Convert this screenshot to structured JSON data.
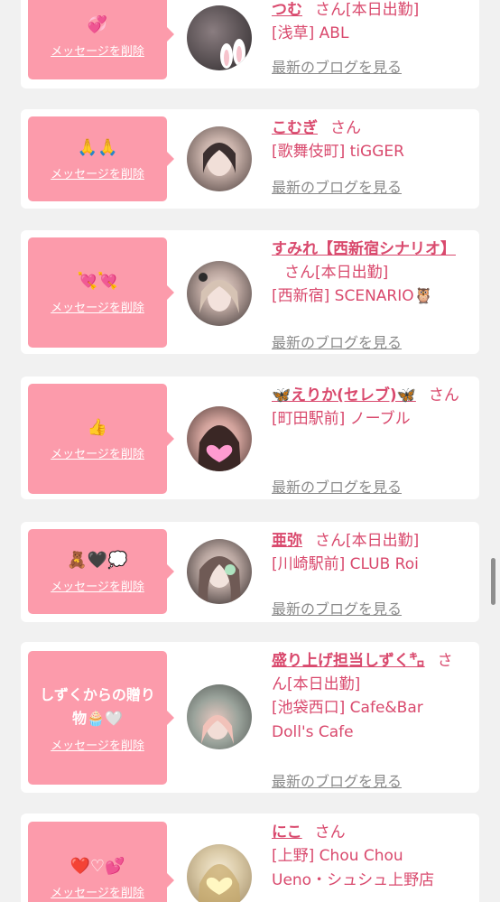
{
  "labels": {
    "delete": "メッセージを削除",
    "blog": "最新のブログを見る",
    "san": "さん"
  },
  "cards": [
    {
      "message": "💞",
      "name": "つむ",
      "status": "[本日出勤]",
      "area_line1": "[浅草] ABL",
      "area_line2": ""
    },
    {
      "message": "🙏🙏",
      "name": "こむぎ",
      "status": "",
      "area_line1": "[歌舞伎町] tiGGER",
      "area_line2": ""
    },
    {
      "message": "💘💘",
      "name": "すみれ【西新宿シナリオ】",
      "status": "[本日出勤]",
      "area_line1": "[西新宿] SCENARIO🦉",
      "area_line2": ""
    },
    {
      "message": "👍",
      "name": "🦋えりか(セレブ)🦋",
      "status": "",
      "area_line1": "[町田駅前] ノーブル",
      "area_line2": ""
    },
    {
      "message": "🧸🖤💭",
      "name": "亜弥",
      "status": "[本日出勤]",
      "area_line1": "[川崎駅前] CLUB Roi",
      "area_line2": ""
    },
    {
      "message": "しずくからの贈り物🧁🤍",
      "name": "盛り上げ担当しずく㌔",
      "status": "[本日出勤]",
      "area_line1": "[池袋西口] Cafe&Bar",
      "area_line2": "Doll's Cafe"
    },
    {
      "message": "❤️♡💕",
      "name": "にこ",
      "status": "",
      "area_line1": "[上野] Chou Chou",
      "area_line2": "Ueno・シュシュ上野店"
    }
  ],
  "colors": {
    "bubble": "#fc9bab",
    "accent": "#d9496d",
    "link_gray": "#8a8a8a",
    "background": "#f1f1f1"
  }
}
